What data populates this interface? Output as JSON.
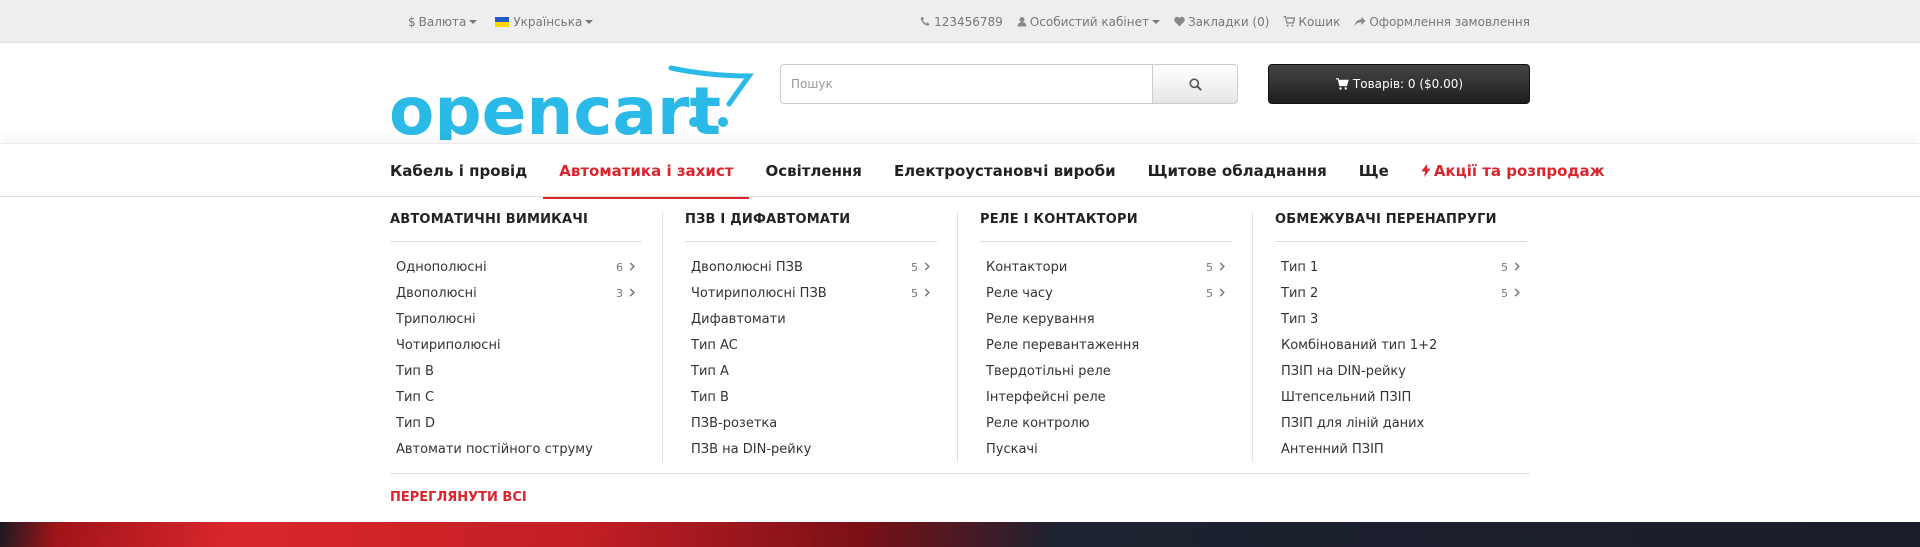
{
  "topbar": {
    "currency_label": "Валюта",
    "currency_symbol": "$",
    "language_label": "Українська",
    "phone": "123456789",
    "account_label": "Особистий кабінет",
    "wishlist_label": "Закладки (0)",
    "cart_link_label": "Кошик",
    "checkout_label": "Оформлення замовлення"
  },
  "header": {
    "logo_text": "opencart",
    "search_placeholder": "Пошук",
    "cart_button_label": "Товарів: 0 ($0.00)"
  },
  "menu": {
    "items": [
      "Кабель і провід",
      "Автоматика і захист",
      "Освітлення",
      "Електроустановчі вироби",
      "Щитове обладнання",
      "Ще"
    ],
    "active_index": 1,
    "sale_label": "Акції та розпродаж"
  },
  "mega": {
    "columns": [
      {
        "title": "АВТОМАТИЧНІ ВИМИКАЧІ",
        "items": [
          {
            "label": "Однополюсні",
            "count": "6"
          },
          {
            "label": "Двополюсні",
            "count": "3"
          },
          {
            "label": "Триполюсні",
            "count": ""
          },
          {
            "label": "Чотириполюсні",
            "count": ""
          },
          {
            "label": "Тип B",
            "count": ""
          },
          {
            "label": "Тип C",
            "count": ""
          },
          {
            "label": "Тип D",
            "count": ""
          },
          {
            "label": "Автомати постійного струму",
            "count": ""
          }
        ]
      },
      {
        "title": "ПЗВ І ДИФАВТОМАТИ",
        "items": [
          {
            "label": "Двополюсні ПЗВ",
            "count": "5"
          },
          {
            "label": "Чотириполюсні ПЗВ",
            "count": "5"
          },
          {
            "label": "Дифавтомати",
            "count": ""
          },
          {
            "label": "Тип AC",
            "count": ""
          },
          {
            "label": "Тип A",
            "count": ""
          },
          {
            "label": "Тип B",
            "count": ""
          },
          {
            "label": "ПЗВ-розетка",
            "count": ""
          },
          {
            "label": "ПЗВ на DIN-рейку",
            "count": ""
          }
        ]
      },
      {
        "title": "РЕЛЕ І КОНТАКТОРИ",
        "items": [
          {
            "label": "Контактори",
            "count": "5"
          },
          {
            "label": "Реле часу",
            "count": "5"
          },
          {
            "label": "Реле керування",
            "count": ""
          },
          {
            "label": "Реле перевантаження",
            "count": ""
          },
          {
            "label": "Твердотільні реле",
            "count": ""
          },
          {
            "label": "Інтерфейсні реле",
            "count": ""
          },
          {
            "label": "Реле контролю",
            "count": ""
          },
          {
            "label": "Пускачі",
            "count": ""
          }
        ]
      },
      {
        "title": "ОБМЕЖУВАЧІ ПЕРЕНАПРУГИ",
        "items": [
          {
            "label": "Тип 1",
            "count": "5"
          },
          {
            "label": "Тип 2",
            "count": "5"
          },
          {
            "label": "Тип 3",
            "count": ""
          },
          {
            "label": "Комбінований тип 1+2",
            "count": ""
          },
          {
            "label": "ПЗІП на DIN-рейку",
            "count": ""
          },
          {
            "label": "Штепсельний ПЗІП",
            "count": ""
          },
          {
            "label": "ПЗІП для ліній даних",
            "count": ""
          },
          {
            "label": "Антенний ПЗІП",
            "count": ""
          }
        ]
      }
    ],
    "view_all_label": "ПЕРЕГЛЯНУТИ ВСІ"
  },
  "colors": {
    "accent": "#d9262d",
    "logo": "#2bb9e7",
    "cart_bg": "#2b2b2b"
  },
  "icons": {
    "phone": "phone-icon",
    "account": "user-icon",
    "wishlist": "heart-icon",
    "cart": "cart-icon",
    "checkout": "share-icon",
    "search": "search-icon",
    "sale": "bolt-icon"
  }
}
